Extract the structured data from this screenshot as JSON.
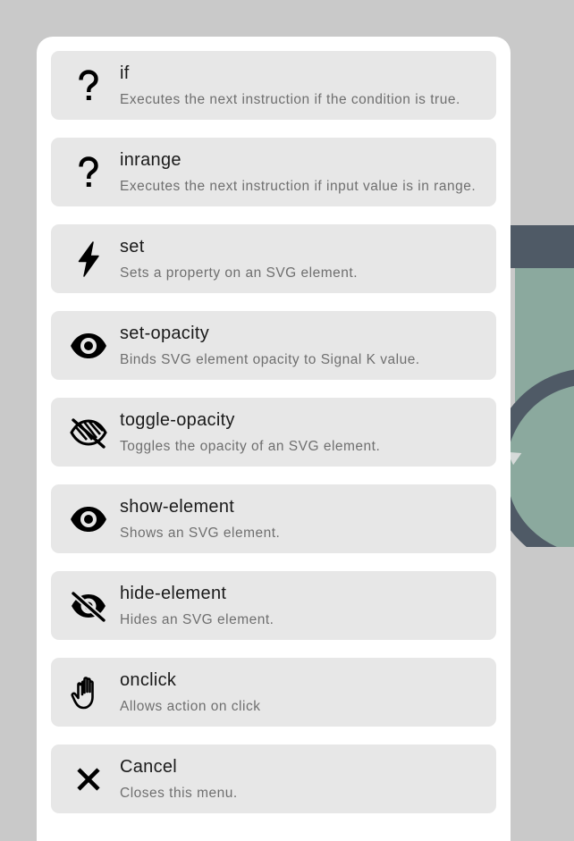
{
  "menu": {
    "items": [
      {
        "icon": "question-mark-icon",
        "title": "if",
        "description": "Executes the next instruction if the condition is true."
      },
      {
        "icon": "question-mark-icon",
        "title": "inrange",
        "description": "Executes the next instruction if input value is in range."
      },
      {
        "icon": "lightning-bolt-icon",
        "title": "set",
        "description": "Sets a property on an SVG element."
      },
      {
        "icon": "eye-icon",
        "title": "set-opacity",
        "description": "Binds SVG element opacity to Signal K value."
      },
      {
        "icon": "eye-hatched-slash-icon",
        "title": "toggle-opacity",
        "description": "Toggles the opacity of an SVG element."
      },
      {
        "icon": "eye-icon",
        "title": "show-element",
        "description": "Shows an SVG element."
      },
      {
        "icon": "eye-slash-icon",
        "title": "hide-element",
        "description": "Hides an SVG element."
      },
      {
        "icon": "hand-icon",
        "title": "onclick",
        "description": "Allows action on click"
      },
      {
        "icon": "close-icon",
        "title": "Cancel",
        "description": "Closes this menu."
      }
    ]
  },
  "colors": {
    "backdrop": "#c9c9c9",
    "sheet": "#ffffff",
    "item": "#e7e7e7",
    "title": "#1a1a1a",
    "description": "#6f6f6f",
    "diagram_dark": "#4f5a66",
    "diagram_green": "#8ba99e"
  }
}
